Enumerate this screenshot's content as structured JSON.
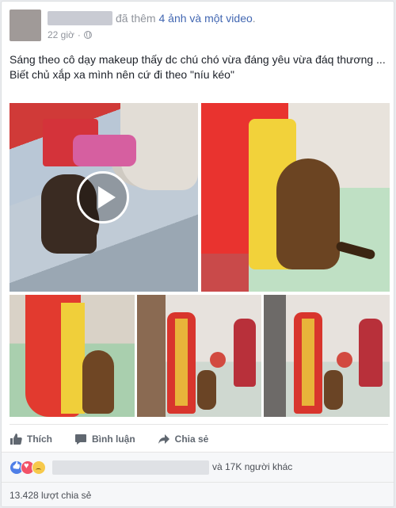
{
  "post": {
    "action_prefix": "đã thêm ",
    "action_link": "4 ảnh và một video",
    "action_suffix": ".",
    "timestamp": "22 giờ",
    "separator": "·",
    "privacy_icon": "globe-icon",
    "text_line1": "Sáng theo cô dạy makeup thấy dc chú chó vừa đáng yêu vừa đáq thương ...",
    "text_line2": "Biết chủ xắp xa mình nên cứ đi theo \"níu kéo\""
  },
  "media": {
    "video_play_icon": "play-icon",
    "photo_count": 5
  },
  "actions": {
    "like_label": "Thích",
    "comment_label": "Bình luận",
    "share_label": "Chia sẻ"
  },
  "reactions": {
    "types": [
      "like",
      "love",
      "sad"
    ],
    "others_text": "và 17K người khác"
  },
  "shares": {
    "count_text": "13.428 lượt chia sẻ"
  },
  "colors": {
    "link": "#4267b2",
    "muted": "#90949c",
    "action": "#606770"
  }
}
